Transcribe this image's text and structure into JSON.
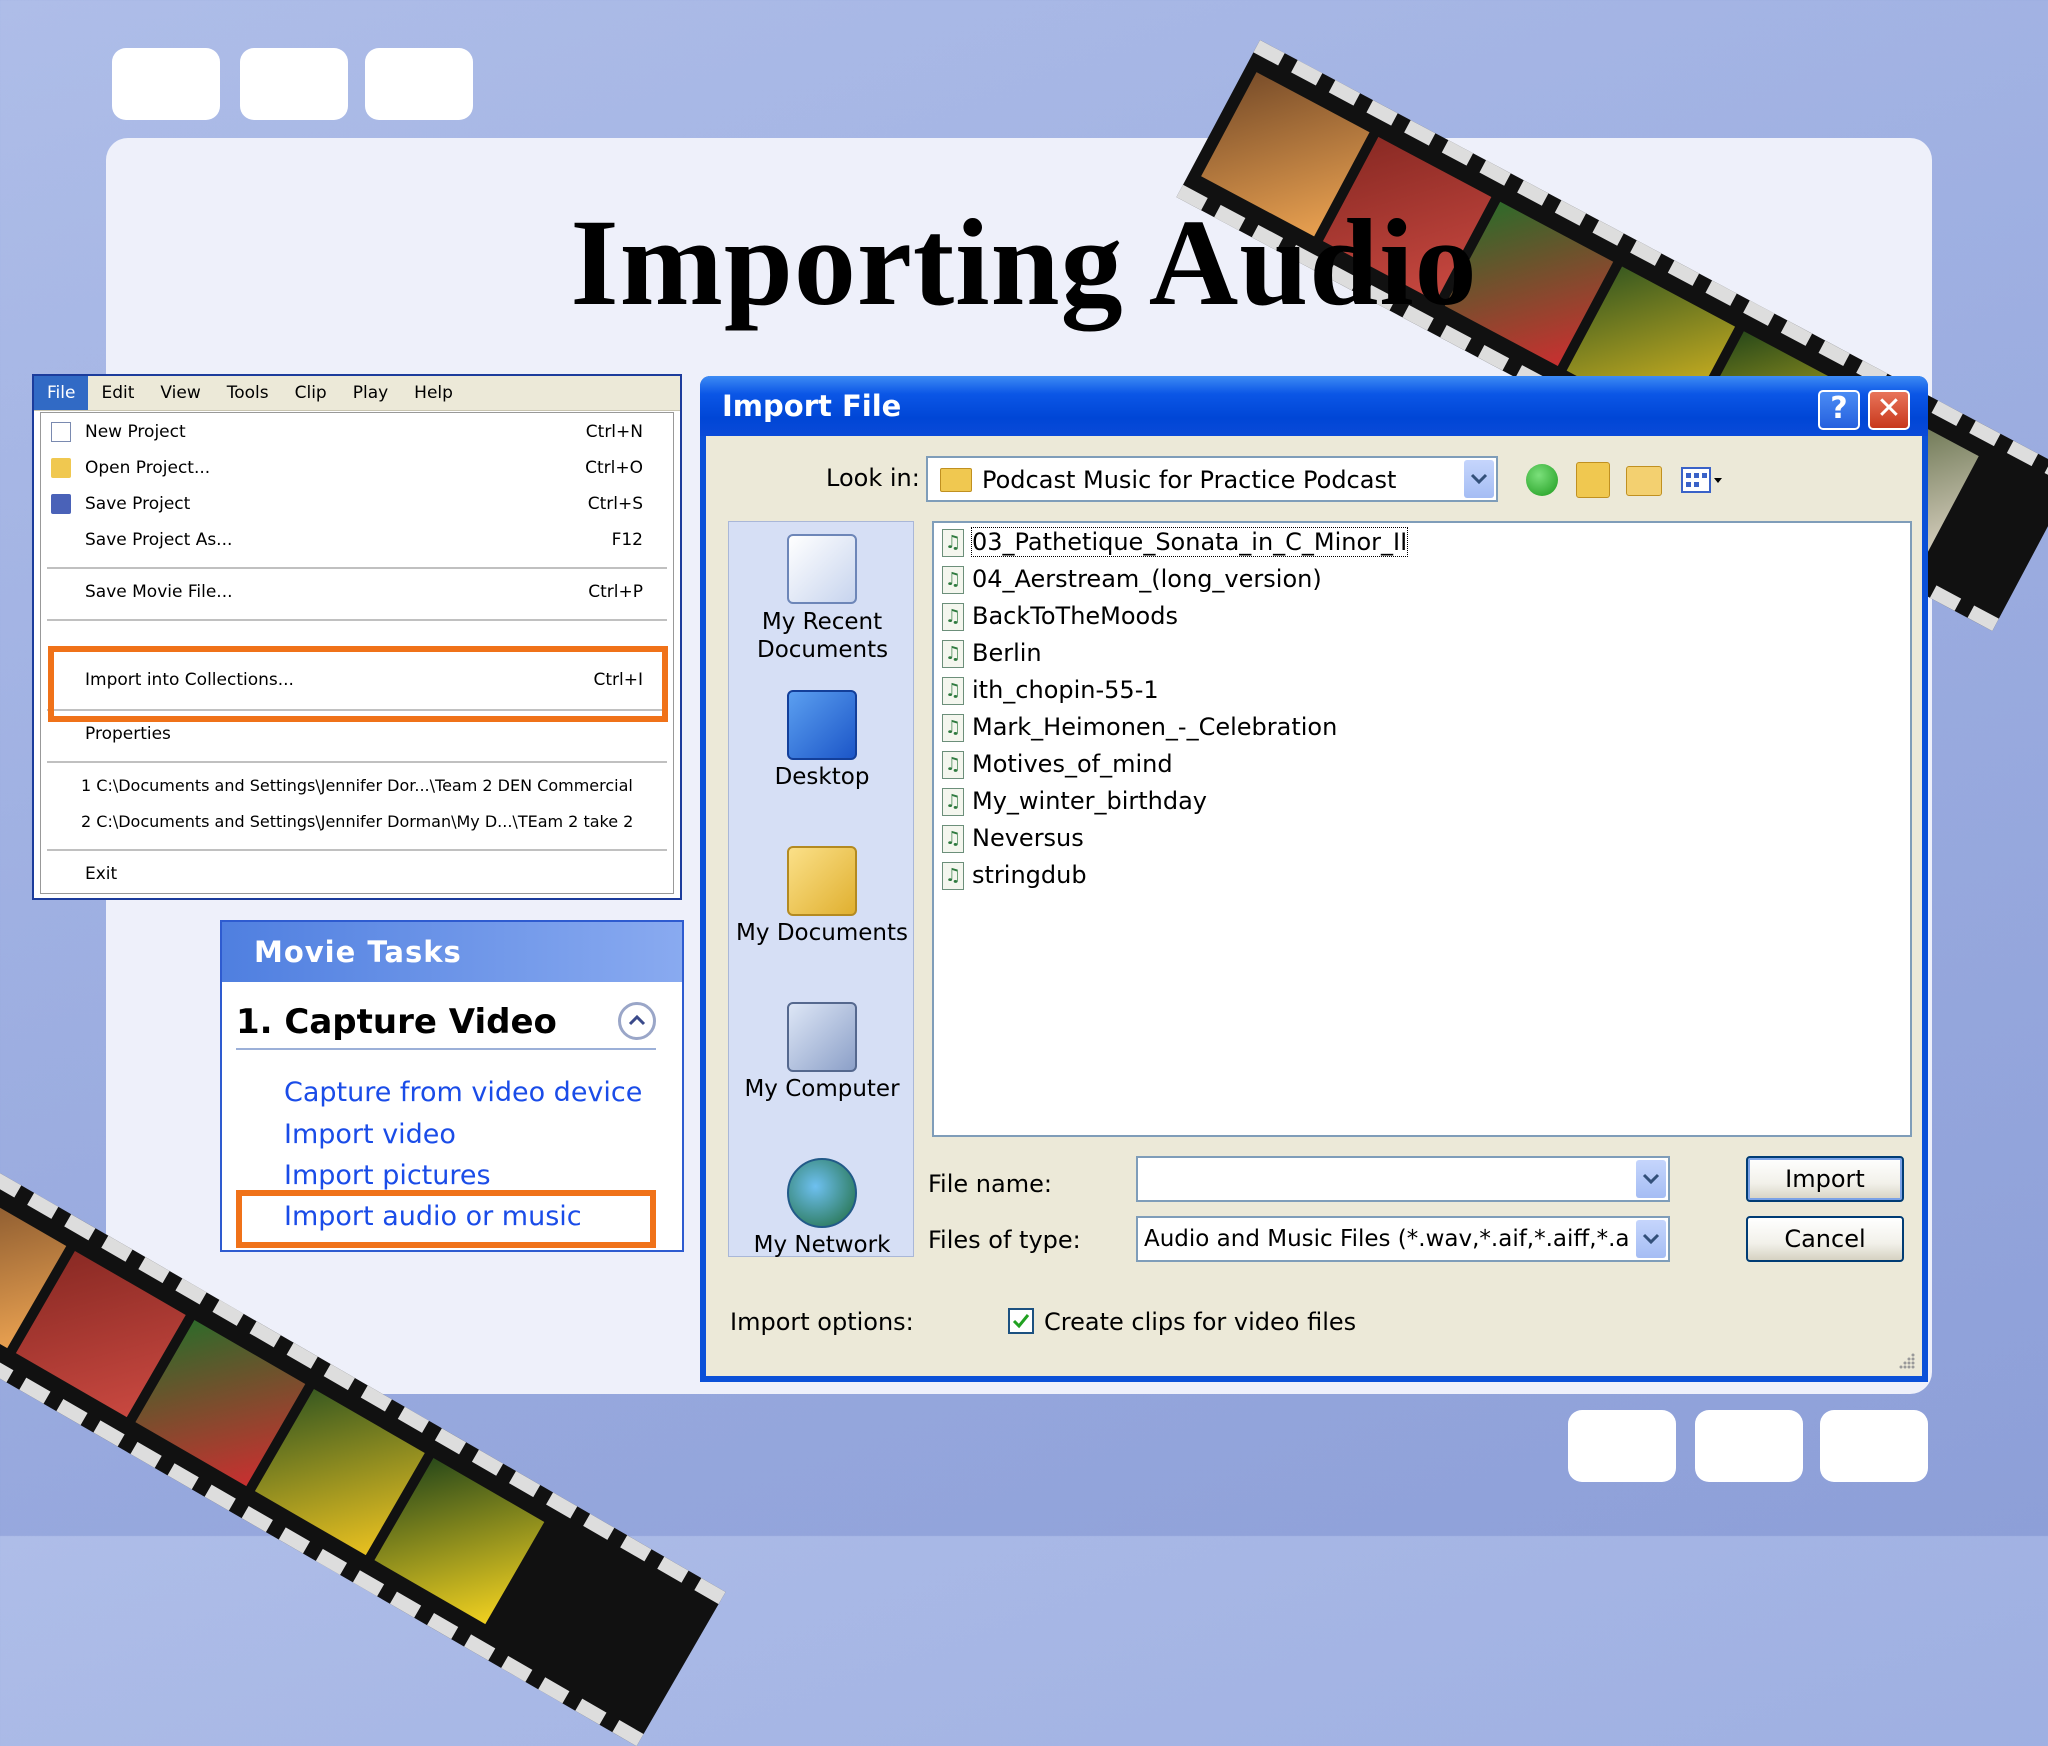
{
  "slide": {
    "title": "Importing Audio"
  },
  "menu": {
    "bar": [
      "File",
      "Edit",
      "View",
      "Tools",
      "Clip",
      "Play",
      "Help"
    ],
    "active": "File",
    "items": [
      {
        "label": "New Project",
        "shortcut": "Ctrl+N",
        "icon": "new-project-icon"
      },
      {
        "label": "Open Project...",
        "shortcut": "Ctrl+O",
        "icon": "open-folder-icon"
      },
      {
        "label": "Save Project",
        "shortcut": "Ctrl+S",
        "icon": "save-disk-icon"
      },
      {
        "label": "Save Project As...",
        "shortcut": "F12"
      },
      {
        "label": "Save Movie File...",
        "shortcut": "Ctrl+P"
      },
      {
        "label": "Import into Collections...",
        "shortcut": "Ctrl+I"
      },
      {
        "label": "Properties",
        "shortcut": ""
      },
      {
        "label": "1 C:\\Documents and Settings\\Jennifer Dor...\\Team 2 DEN Commercial",
        "shortcut": ""
      },
      {
        "label": "2 C:\\Documents and Settings\\Jennifer Dorman\\My D...\\TEam 2 take 2",
        "shortcut": ""
      },
      {
        "label": "Exit",
        "shortcut": ""
      }
    ],
    "highlight_color": "#f07219"
  },
  "tasks": {
    "header": "Movie Tasks",
    "section": "1. Capture Video",
    "links": [
      "Capture from video device",
      "Import video",
      "Import pictures",
      "Import audio or music"
    ]
  },
  "dialog": {
    "title": "Import File",
    "help_glyph": "?",
    "close_glyph": "✕",
    "look_in_label": "Look in:",
    "look_in_value": "Podcast Music for Practice Podcast",
    "places": [
      "My Recent Documents",
      "Desktop",
      "My Documents",
      "My Computer",
      "My Network"
    ],
    "files": [
      "03_Pathetique_Sonata_in_C_Minor_II",
      "04_Aerstream_(long_version)",
      "BackToTheMoods",
      "Berlin",
      "ith_chopin-55-1",
      "Mark_Heimonen_-_Celebration",
      "Motives_of_mind",
      "My_winter_birthday",
      "Neversus",
      "stringdub"
    ],
    "file_name_label": "File name:",
    "file_name_value": "",
    "files_of_type_label": "Files of type:",
    "files_of_type_value": "Audio and Music Files (*.wav,*.aif,*.aiff,*.aifc,*.s",
    "import_button": "Import",
    "cancel_button": "Cancel",
    "import_options_label": "Import options:",
    "create_clips_label": "Create clips for video files",
    "create_clips_checked": true,
    "accent": "#0a50d8"
  }
}
